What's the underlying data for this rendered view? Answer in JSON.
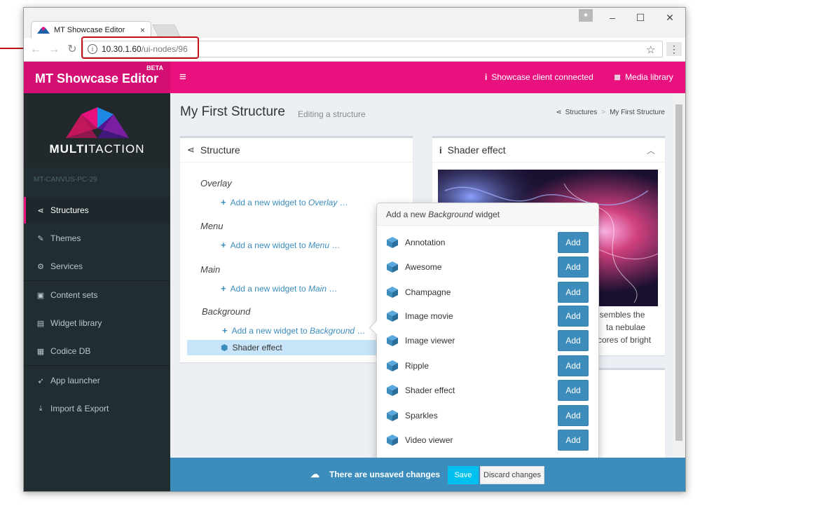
{
  "browser": {
    "tab_title": "MT Showcase Editor",
    "tab_close": "×",
    "url_host": "10.30.1.60",
    "url_path": "/ui-nodes/96",
    "minimize": "–",
    "maximize": "☐",
    "close": "✕"
  },
  "header": {
    "brand": "MT Showcase Editor",
    "beta": "BETA",
    "menu_icon": "≡",
    "client_status": "Showcase client connected",
    "media_library": "Media library"
  },
  "sidebar": {
    "logo_text_bold": "MULTI",
    "logo_text_rest": "TACTION",
    "host": "MT-CANVUS-PC-29",
    "items": [
      {
        "label": "Structures",
        "icon": "share-icon",
        "glyph": "⋖"
      },
      {
        "label": "Themes",
        "icon": "brush-icon",
        "glyph": "✎"
      },
      {
        "label": "Services",
        "icon": "cogs-icon",
        "glyph": "⚙"
      },
      {
        "label": "Content sets",
        "icon": "image-icon",
        "glyph": "▣"
      },
      {
        "label": "Widget library",
        "icon": "book-icon",
        "glyph": "▤"
      },
      {
        "label": "Codice DB",
        "icon": "barcode-icon",
        "glyph": "▦"
      },
      {
        "label": "App launcher",
        "icon": "rocket-icon",
        "glyph": "➶"
      },
      {
        "label": "Import & Export",
        "icon": "download-icon",
        "glyph": "⤓"
      }
    ]
  },
  "page": {
    "title": "My First Structure",
    "subtitle": "Editing a structure",
    "breadcrumb_root": "Structures",
    "breadcrumb_sep": ">",
    "breadcrumb_current": "My First Structure"
  },
  "structure": {
    "title": "Structure",
    "add_prefix": "Add a new widget to",
    "ellipsis": "…",
    "sections": [
      {
        "label": "Overlay"
      },
      {
        "label": "Menu"
      },
      {
        "label": "Main"
      },
      {
        "label": "Background"
      }
    ],
    "selected_widget": "Shader effect"
  },
  "shader_panel": {
    "title": "Shader effect",
    "description_lines": [
      "esembles the",
      "ta nebulae",
      "cores of bright"
    ]
  },
  "popover": {
    "title_prefix": "Add a new",
    "title_em": "Background",
    "title_suffix": "widget",
    "add_label": "Add",
    "widgets": [
      "Annotation",
      "Awesome",
      "Champagne",
      "Image movie",
      "Image viewer",
      "Ripple",
      "Shader effect",
      "Sparkles",
      "Video viewer"
    ]
  },
  "footer": {
    "message": "There are unsaved changes",
    "save": "Save",
    "discard": "Discard changes"
  },
  "colors": {
    "accent_pink": "#e8117e",
    "sidebar_bg": "#222d32",
    "primary_blue": "#3c8dbc",
    "callout_red": "#c0151b"
  }
}
